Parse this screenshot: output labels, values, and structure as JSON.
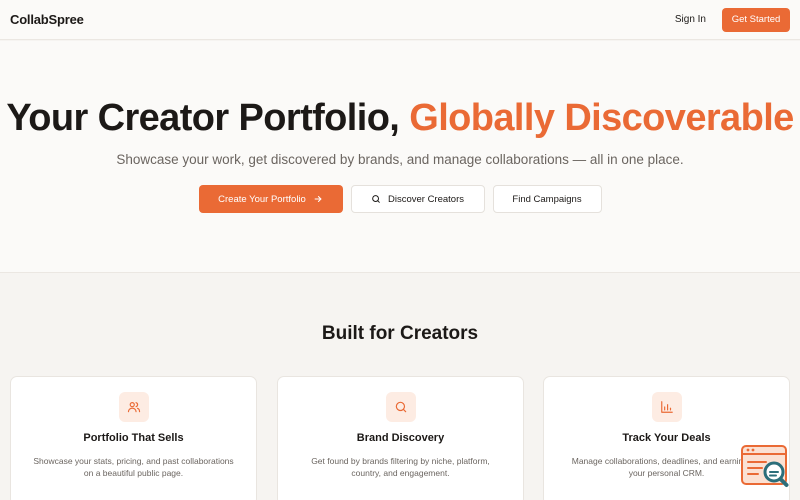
{
  "header": {
    "brand": "CollabSpree",
    "sign_in": "Sign In",
    "get_started": "Get Started"
  },
  "hero": {
    "title_main": "Your Creator Portfolio, ",
    "title_accent": "Globally Discoverable",
    "subtitle": "Showcase your work, get discovered by brands, and manage collaborations — all in one place.",
    "actions": {
      "create_portfolio": "Create Your Portfolio",
      "discover_creators": "Discover Creators",
      "find_campaigns": "Find Campaigns"
    }
  },
  "features": {
    "title": "Built for Creators",
    "cards": [
      {
        "icon": "users-icon",
        "title": "Portfolio That Sells",
        "desc": "Showcase your stats, pricing, and past collaborations on a beautiful public page."
      },
      {
        "icon": "search-icon",
        "title": "Brand Discovery",
        "desc": "Get found by brands filtering by niche, platform, country, and engagement."
      },
      {
        "icon": "bar-chart-icon",
        "title": "Track Your Deals",
        "desc": "Manage collaborations, deadlines, and earnings in your personal CRM."
      }
    ]
  },
  "colors": {
    "accent": "#ea6a35",
    "accent_soft": "#fdece3",
    "text": "#1c1917",
    "muted": "#6b6560",
    "background": "#f6f4f1"
  }
}
